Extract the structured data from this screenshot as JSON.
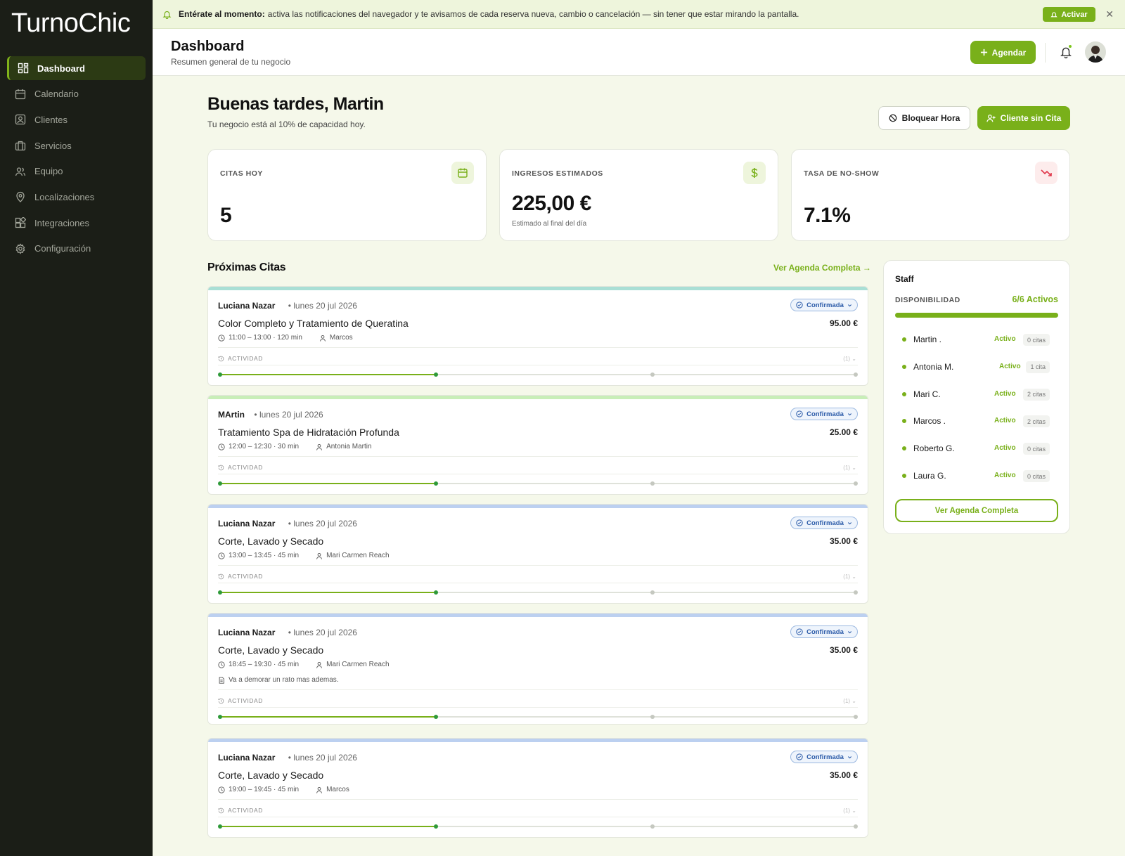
{
  "brand": {
    "logo": "TurnoChic"
  },
  "sidebar": {
    "items": [
      {
        "label": "Dashboard",
        "icon": "dashboard-icon",
        "active": true
      },
      {
        "label": "Calendario",
        "icon": "calendar-icon"
      },
      {
        "label": "Clientes",
        "icon": "clients-icon"
      },
      {
        "label": "Servicios",
        "icon": "services-icon"
      },
      {
        "label": "Equipo",
        "icon": "team-icon"
      },
      {
        "label": "Localizaciones",
        "icon": "location-icon"
      },
      {
        "label": "Integraciones",
        "icon": "integrations-icon"
      },
      {
        "label": "Configuración",
        "icon": "settings-icon"
      }
    ]
  },
  "banner": {
    "bold": "Entérate al momento:",
    "text": "activa las notificaciones del navegador y te avisamos de cada reserva nueva, cambio o cancelación — sin tener que estar mirando la pantalla.",
    "button": "Activar",
    "close": "✕"
  },
  "header": {
    "title": "Dashboard",
    "subtitle": "Resumen general de tu negocio",
    "agendar": "Agendar"
  },
  "greeting": {
    "title": "Buenas tardes, Martin",
    "subtitle": "Tu negocio está al 10% de capacidad hoy.",
    "block_button": "Bloquear Hora",
    "walkin_button": "Cliente sin Cita"
  },
  "stats": {
    "citas": {
      "label": "CITAS HOY",
      "value": "5"
    },
    "ingresos": {
      "label": "INGRESOS ESTIMADOS",
      "value": "225,00 €",
      "note": "Estimado al final del día"
    },
    "noshow": {
      "label": "TASA DE NO-SHOW",
      "value": "7.1%"
    }
  },
  "appointments": {
    "title": "Próximas Citas",
    "link": "Ver Agenda Completa →",
    "activity_label": "ACTIVIDAD",
    "activity_count": "(1)",
    "list": [
      {
        "client": "Luciana Nazar",
        "date": "lunes 20 jul 2026",
        "service": "Color Completo y Tratamiento de Queratina",
        "price": "95.00 €",
        "time": "11:00 – 13:00 · 120 min",
        "staff": "Marcos",
        "status": "Confirmada",
        "color": "#a9dfd5"
      },
      {
        "client": "MArtin",
        "date": "lunes 20 jul 2026",
        "service": "Tratamiento Spa de Hidratación Profunda",
        "price": "25.00 €",
        "time": "12:00 – 12:30 · 30 min",
        "staff": "Antonia Martin",
        "status": "Confirmada",
        "color": "#c8eeb8"
      },
      {
        "client": "Luciana Nazar",
        "date": "lunes 20 jul 2026",
        "service": "Corte, Lavado y Secado",
        "price": "35.00 €",
        "time": "13:00 – 13:45 · 45 min",
        "staff": "Mari Carmen Reach",
        "status": "Confirmada",
        "color": "#bcd0f0"
      },
      {
        "client": "Luciana Nazar",
        "date": "lunes 20 jul 2026",
        "service": "Corte, Lavado y Secado",
        "price": "35.00 €",
        "time": "18:45 – 19:30 · 45 min",
        "staff": "Mari Carmen Reach",
        "note": "Va a demorar un rato mas ademas.",
        "status": "Confirmada",
        "color": "#bcd0f0"
      },
      {
        "client": "Luciana Nazar",
        "date": "lunes 20 jul 2026",
        "service": "Corte, Lavado y Secado",
        "price": "35.00 €",
        "time": "19:00 – 19:45 · 45 min",
        "staff": "Marcos",
        "status": "Confirmada",
        "color": "#bcd0f0"
      }
    ],
    "progress": 0.34
  },
  "staff": {
    "title": "Staff",
    "availability_label": "DISPONIBILIDAD",
    "count": "6/6 Activos",
    "availability": 1.0,
    "members": [
      {
        "name": "Martin .",
        "status": "Activo",
        "citas": "0 citas"
      },
      {
        "name": "Antonia M.",
        "status": "Activo",
        "citas": "1 cita"
      },
      {
        "name": "Mari C.",
        "status": "Activo",
        "citas": "2 citas"
      },
      {
        "name": "Marcos .",
        "status": "Activo",
        "citas": "2 citas"
      },
      {
        "name": "Roberto G.",
        "status": "Activo",
        "citas": "0 citas"
      },
      {
        "name": "Laura G.",
        "status": "Activo",
        "citas": "0 citas"
      }
    ],
    "button": "Ver Agenda Completa"
  },
  "colors": {
    "accent": "#79b01a",
    "sidebar": "#1b1e17",
    "background": "#f5f8ea"
  }
}
